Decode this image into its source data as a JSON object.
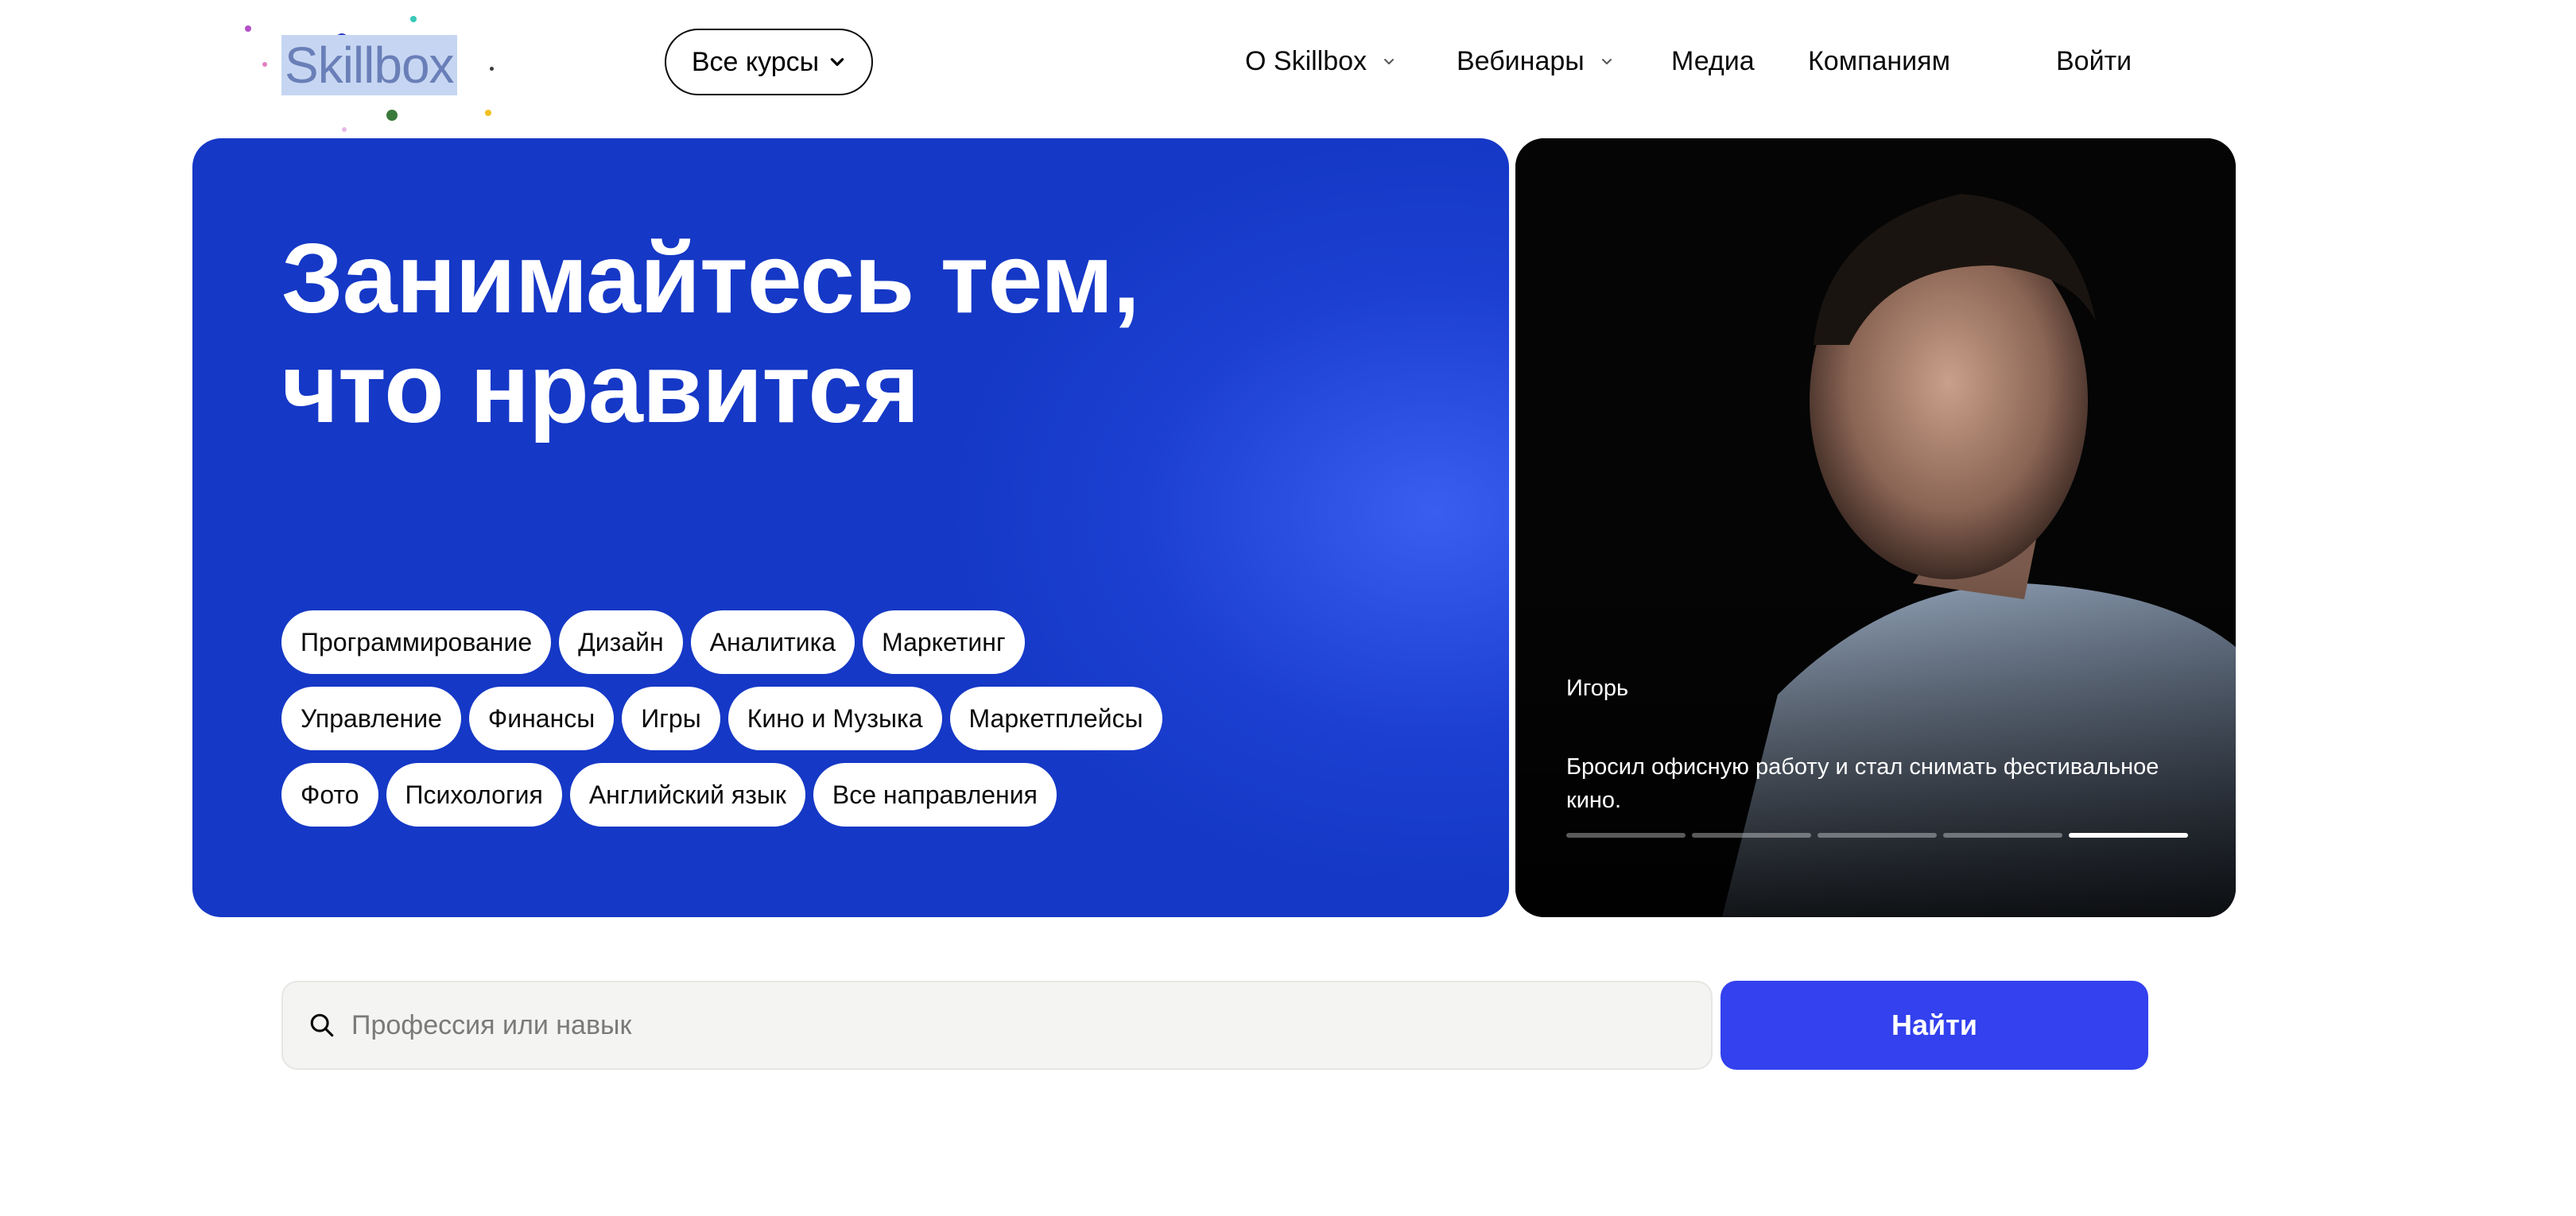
{
  "header": {
    "logo": "Skillbox",
    "all_courses_label": "Все курсы",
    "nav": {
      "about": "О Skillbox",
      "webinars": "Вебинары",
      "media": "Медиа",
      "companies": "Компаниям",
      "login": "Войти"
    }
  },
  "hero": {
    "title_line1": "Занимайтесь тем,",
    "title_line2": "что нравится",
    "chips_row1": [
      "Программирование",
      "Дизайн",
      "Аналитика",
      "Маркетинг"
    ],
    "chips_row2": [
      "Управление",
      "Финансы",
      "Игры",
      "Кино и Музыка",
      "Маркетплейсы"
    ],
    "chips_row3": [
      "Фото",
      "Психология",
      "Английский язык",
      "Все направления"
    ]
  },
  "story": {
    "name": "Игорь",
    "text": "Бросил офисную работу и стал снимать фестивальное кино.",
    "segments_total": 5,
    "active_segment": 5
  },
  "search": {
    "placeholder": "Профессия или навык",
    "value": "",
    "button_label": "Найти"
  },
  "colors": {
    "hero_blue": "#1c3fd1",
    "button_blue": "#3341ee",
    "search_bg": "#f4f4f2"
  },
  "icons": {
    "search": "search-icon",
    "dropdown": "chevron-down-icon"
  }
}
